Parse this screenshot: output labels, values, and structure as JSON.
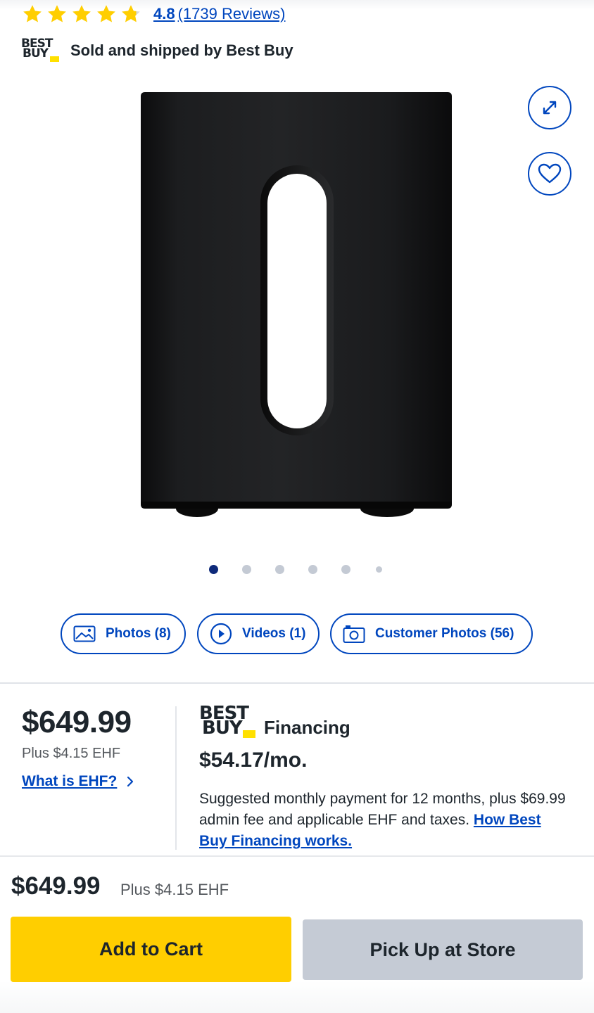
{
  "rating": {
    "score": "4.8",
    "reviews": "(1739 Reviews)",
    "stars_filled": 4.8,
    "star_color": "#ffce00"
  },
  "seller": {
    "logo_line1": "BEST",
    "logo_line2": "BUY",
    "text": "Sold and shipped by Best Buy"
  },
  "image_actions": {
    "expand_icon": "expand-arrows-icon",
    "wishlist_icon": "heart-icon"
  },
  "carousel": {
    "count": 6,
    "active_index": 0
  },
  "media": {
    "photos": "Photos (8)",
    "videos": "Videos (1)",
    "customer_photos": "Customer Photos (56)"
  },
  "pricing": {
    "price": "$649.99",
    "ehf": "Plus $4.15 EHF",
    "ehf_link": "What is EHF?"
  },
  "financing": {
    "logo_line1": "BEST",
    "logo_line2": "BUY",
    "title": "Financing",
    "monthly": "$54.17/mo.",
    "description": "Suggested monthly payment for 12 months, plus $69.99 admin fee and applicable EHF and taxes.",
    "link": "How Best Buy Financing works."
  },
  "bottom_bar": {
    "price": "$649.99",
    "ehf": "Plus $4.15 EHF",
    "add_to_cart": "Add to Cart",
    "pick_up": "Pick Up at Store"
  },
  "colors": {
    "link_blue": "#0046be",
    "brand_yellow": "#ffce00",
    "tag_yellow": "#ffe000",
    "pickup_gray": "#c5cbd5",
    "text_dark": "#1d252c"
  }
}
